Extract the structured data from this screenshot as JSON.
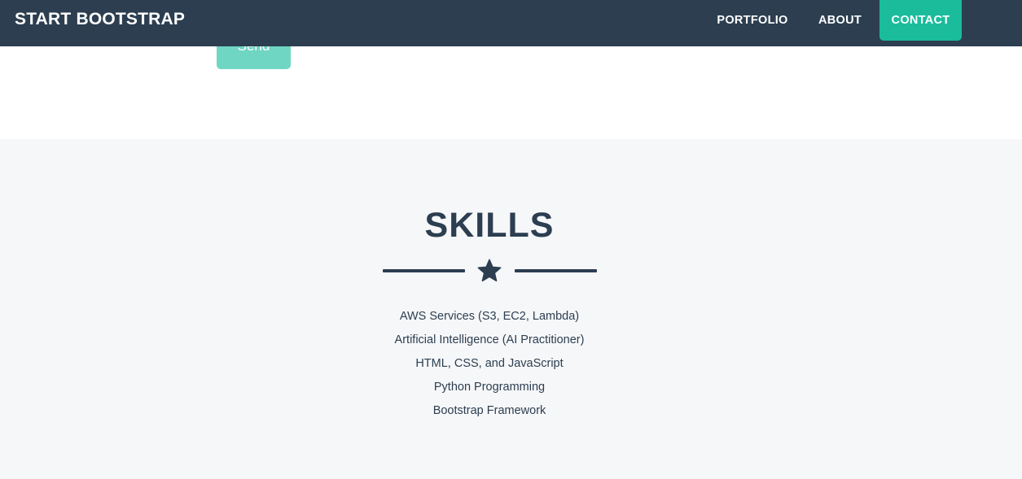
{
  "navbar": {
    "brand": "START BOOTSTRAP",
    "links": [
      {
        "label": "PORTFOLIO"
      },
      {
        "label": "ABOUT"
      },
      {
        "label": "CONTACT",
        "active": true
      }
    ]
  },
  "contact": {
    "send_label": "Send"
  },
  "skills": {
    "title": "SKILLS",
    "divider_icon": "star-icon",
    "items": [
      "AWS Services (S3, EC2, Lambda)",
      "Artificial Intelligence (AI Practitioner)",
      "HTML, CSS, and JavaScript",
      "Python Programming",
      "Bootstrap Framework"
    ]
  },
  "colors": {
    "navbar_bg": "#2c3e50",
    "accent": "#1abc9c",
    "send_button": "#6fd6c3",
    "section_bg": "#f6f7f9",
    "text_dark": "#2c3e50"
  }
}
